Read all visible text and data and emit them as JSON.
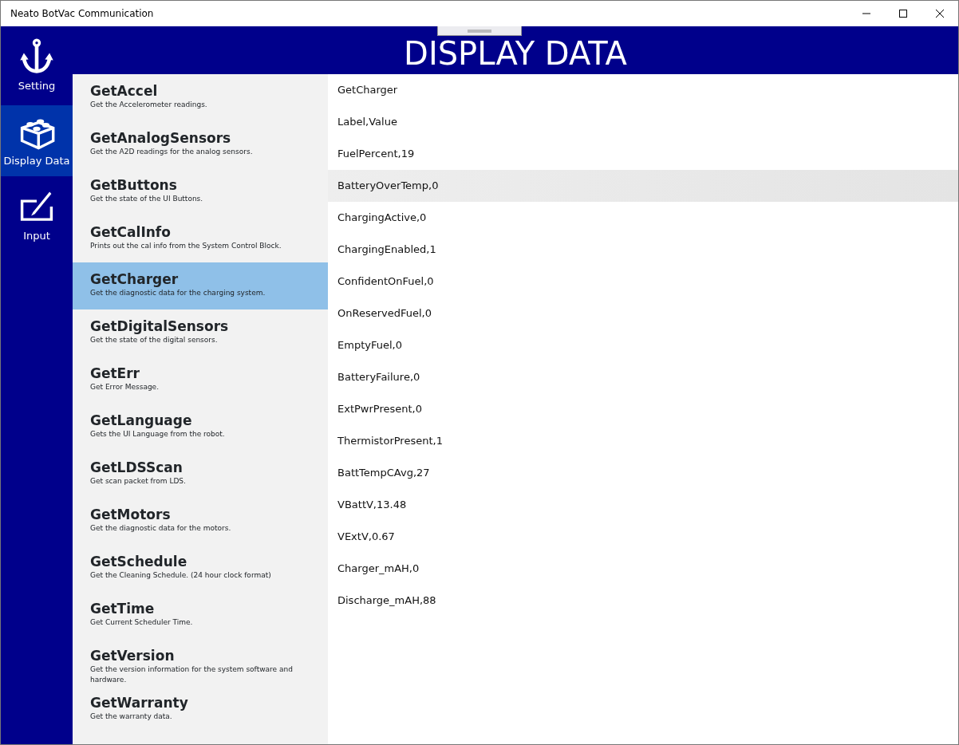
{
  "window": {
    "title": "Neato BotVac Communication"
  },
  "nav": [
    {
      "label": "Setting",
      "kind": "anchor",
      "selected": false
    },
    {
      "label": "Display Data",
      "kind": "brick",
      "selected": true
    },
    {
      "label": "Input",
      "kind": "pen",
      "selected": false
    }
  ],
  "header": {
    "title": "DISPLAY DATA"
  },
  "commands": [
    {
      "name": "GetAccel",
      "description": "Get the Accelerometer readings.",
      "selected": false
    },
    {
      "name": "GetAnalogSensors",
      "description": "Get the A2D readings for the analog sensors.",
      "selected": false
    },
    {
      "name": "GetButtons",
      "description": "Get the state of the UI Buttons.",
      "selected": false
    },
    {
      "name": "GetCalInfo",
      "description": "Prints out the cal info from the System Control Block.",
      "selected": false
    },
    {
      "name": "GetCharger",
      "description": "Get the diagnostic data for the charging system.",
      "selected": true
    },
    {
      "name": "GetDigitalSensors",
      "description": "Get the state of the digital sensors.",
      "selected": false
    },
    {
      "name": "GetErr",
      "description": "Get Error Message.",
      "selected": false
    },
    {
      "name": "GetLanguage",
      "description": "Gets the UI Language from the robot.",
      "selected": false
    },
    {
      "name": "GetLDSScan",
      "description": "Get scan packet from LDS.",
      "selected": false
    },
    {
      "name": "GetMotors",
      "description": "Get the diagnostic data for the motors.",
      "selected": false
    },
    {
      "name": "GetSchedule",
      "description": "Get the Cleaning Schedule. (24 hour clock format)",
      "selected": false
    },
    {
      "name": "GetTime",
      "description": "Get Current Scheduler Time.",
      "selected": false
    },
    {
      "name": "GetVersion",
      "description": "Get the version information for the system software and hardware.",
      "selected": false
    },
    {
      "name": "GetWarranty",
      "description": "Get the warranty data.",
      "selected": false
    }
  ],
  "output": [
    {
      "text": "GetCharger",
      "hovered": false
    },
    {
      "text": "Label,Value",
      "hovered": false
    },
    {
      "text": "FuelPercent,19",
      "hovered": false
    },
    {
      "text": "BatteryOverTemp,0",
      "hovered": true
    },
    {
      "text": "ChargingActive,0",
      "hovered": false
    },
    {
      "text": "ChargingEnabled,1",
      "hovered": false
    },
    {
      "text": "ConfidentOnFuel,0",
      "hovered": false
    },
    {
      "text": "OnReservedFuel,0",
      "hovered": false
    },
    {
      "text": "EmptyFuel,0",
      "hovered": false
    },
    {
      "text": "BatteryFailure,0",
      "hovered": false
    },
    {
      "text": "ExtPwrPresent,0",
      "hovered": false
    },
    {
      "text": "ThermistorPresent,1",
      "hovered": false
    },
    {
      "text": "BattTempCAvg,27",
      "hovered": false
    },
    {
      "text": "VBattV,13.48",
      "hovered": false
    },
    {
      "text": "VExtV,0.67",
      "hovered": false
    },
    {
      "text": "Charger_mAH,0",
      "hovered": false
    },
    {
      "text": "Discharge_mAH,88",
      "hovered": false
    }
  ]
}
